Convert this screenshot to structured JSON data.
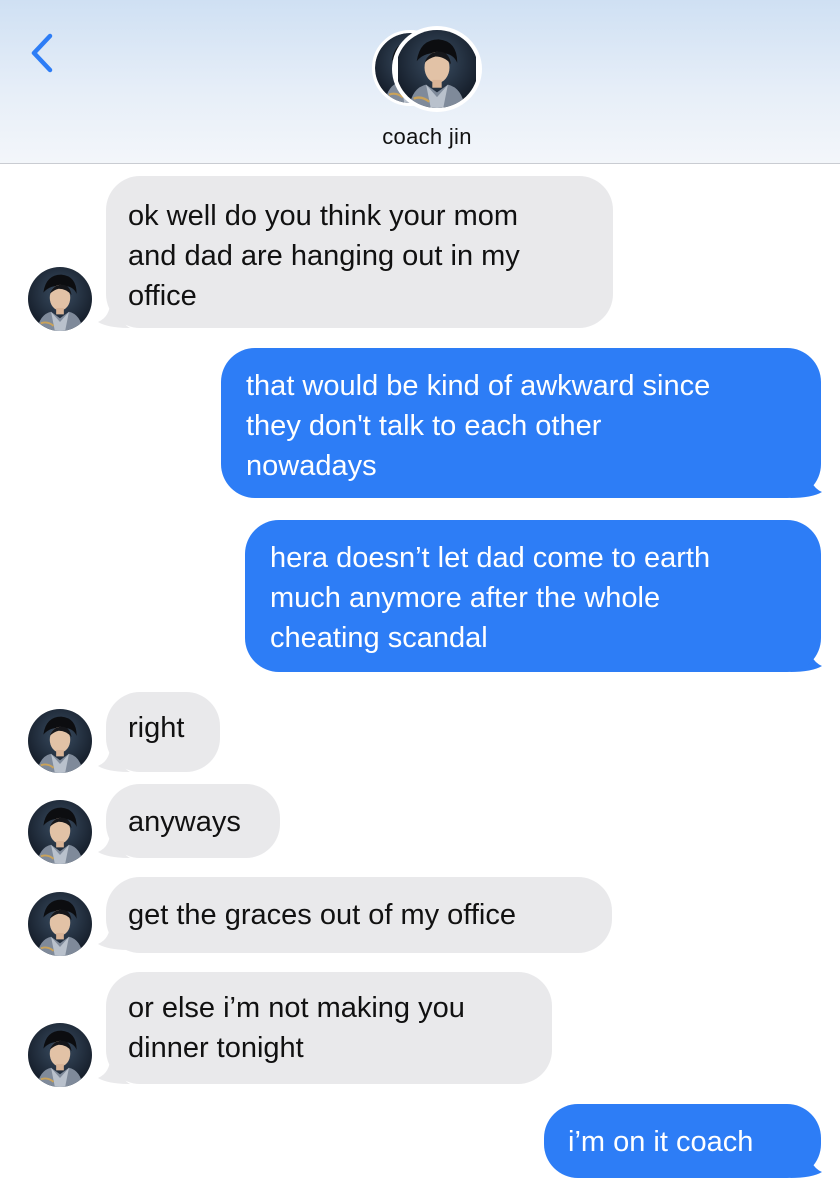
{
  "header": {
    "contact_name": "coach jin",
    "back_icon": "chevron-left-icon"
  },
  "colors": {
    "incoming_bubble": "#e9e9eb",
    "outgoing_bubble": "#2d7df6",
    "accent": "#2d7df6"
  },
  "messages": [
    {
      "direction": "incoming",
      "text": "ok well do you think your mom\nand dad are hanging out in my\noffice"
    },
    {
      "direction": "outgoing",
      "text": "that would be kind of awkward since\nthey don't talk to each other\nnowadays"
    },
    {
      "direction": "outgoing",
      "text": "hera doesn’t let dad come to earth\nmuch anymore after the whole\ncheating scandal"
    },
    {
      "direction": "incoming",
      "text": "right"
    },
    {
      "direction": "incoming",
      "text": "anyways"
    },
    {
      "direction": "incoming",
      "text": "get the graces out of my office"
    },
    {
      "direction": "incoming",
      "text": "or else i’m not making you\ndinner tonight"
    },
    {
      "direction": "outgoing",
      "text": "i’m on it coach"
    }
  ]
}
